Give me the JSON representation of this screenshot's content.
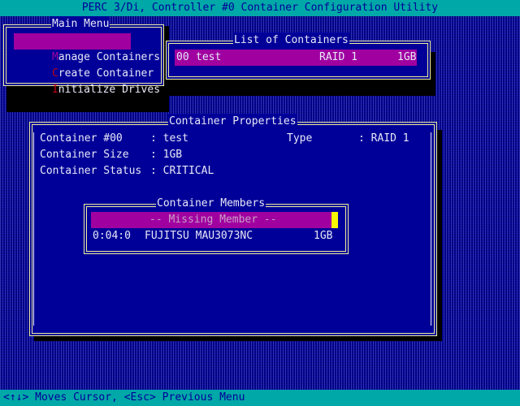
{
  "title": "PERC 3/Di, Controller #0 Container Configuration Utility",
  "main_menu": {
    "title": "Main Menu",
    "items": [
      {
        "hotkey": "M",
        "rest": "anage Containers",
        "selected": true
      },
      {
        "hotkey": "C",
        "rest": "reate Container",
        "selected": false
      },
      {
        "hotkey": "I",
        "rest": "nitialize Drives",
        "selected": false
      }
    ]
  },
  "containers_list": {
    "title": "List of Containers",
    "rows": [
      {
        "id": "00",
        "name": "test",
        "raid": "RAID 1",
        "size": "1GB"
      }
    ]
  },
  "properties": {
    "title": "Container Properties",
    "container_label": "Container #00",
    "container_value": ": test",
    "type_label": "Type",
    "type_value": ": RAID 1",
    "size_label": "Container Size",
    "size_value": ": 1GB",
    "status_label": "Container Status",
    "status_value": ": CRITICAL"
  },
  "members": {
    "title": "Container Members",
    "missing_label": "-- Missing Member --",
    "rows": [
      {
        "address": "0:04:0",
        "model": "FUJITSU MAU3073NC",
        "size": "1GB"
      }
    ]
  },
  "status_bar": "<↑↓> Moves Cursor, <Esc> Previous Menu",
  "colors": {
    "screen_bg": "#000098",
    "bar_bg": "#00a8a8",
    "highlight": "#a000a0",
    "hotkey": "#c00018",
    "frame": "#f0f0a0",
    "cursor": "#f8f800"
  }
}
